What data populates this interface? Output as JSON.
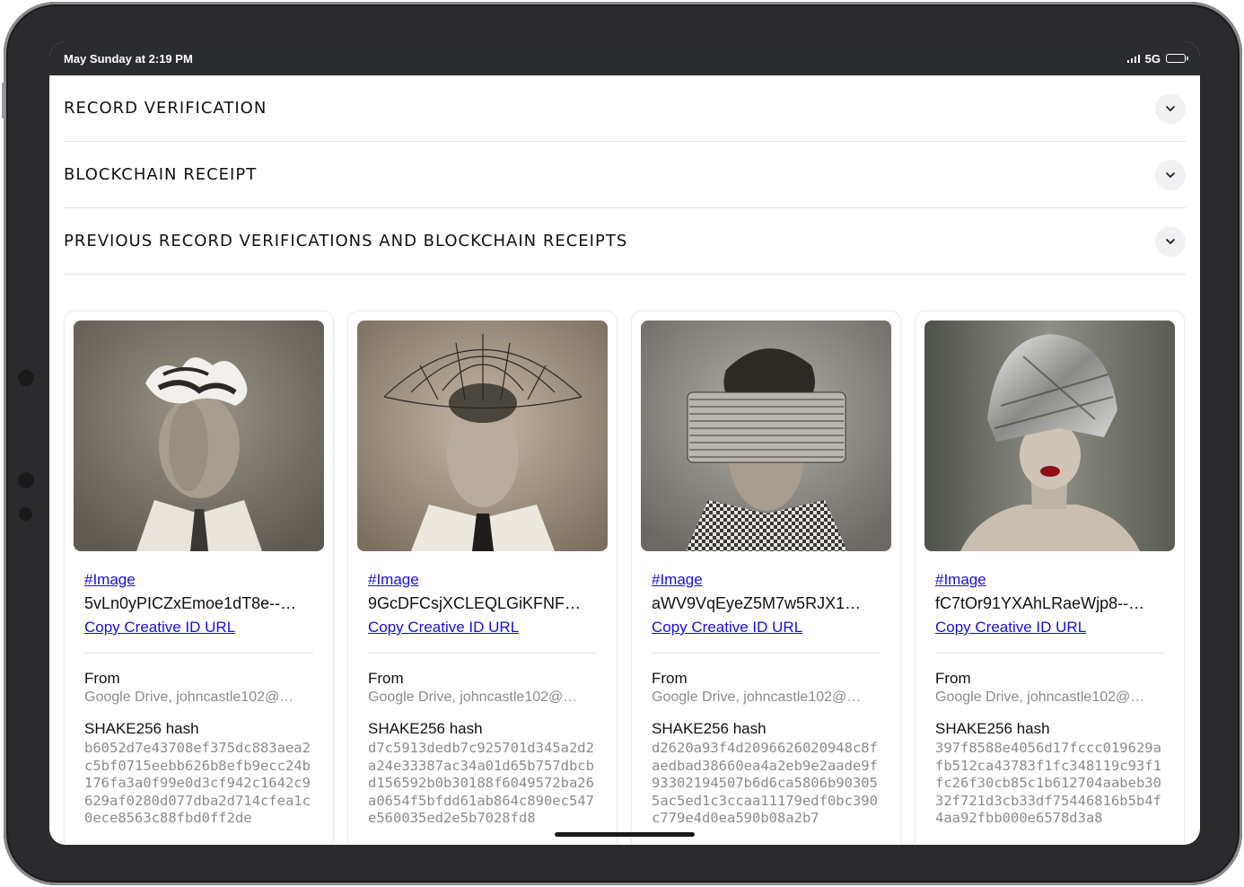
{
  "status": {
    "time": "May Sunday at 2:19 PM",
    "network": "5G"
  },
  "accordion": [
    {
      "title": "RECORD VERIFICATION"
    },
    {
      "title": "BLOCKCHAIN RECEIPT"
    },
    {
      "title": "PREVIOUS RECORD VERIFICATIONS AND BLOCKCHAIN RECEIPTS"
    }
  ],
  "cards": [
    {
      "tag": "#Image",
      "creative_id": "5vLn0yPICZxEmoe1dT8e--…",
      "copy_label": "Copy Creative ID URL",
      "from_label": "From",
      "from_value": "Google Drive, johncastle102@…",
      "hash_label": "SHAKE256 hash",
      "hash_value": "b6052d7e43708ef375dc883aea2c5bf0715eebb626b8efb9ecc24b176fa3a0f99e0d3cf942c1642c9629af0280d077dba2d714cfea1c0ece8563c88fbd0ff2de"
    },
    {
      "tag": "#Image",
      "creative_id": "9GcDFCsjXCLEQLGiKFNF…",
      "copy_label": "Copy Creative ID URL",
      "from_label": "From",
      "from_value": "Google Drive, johncastle102@…",
      "hash_label": "SHAKE256 hash",
      "hash_value": "d7c5913dedb7c925701d345a2d2a24e33387ac34a01d65b757dbcbd156592b0b30188f6049572ba26a0654f5bfdd61ab864c890ec547e560035ed2e5b7028fd8"
    },
    {
      "tag": "#Image",
      "creative_id": "aWV9VqEyeZ5M7w5RJX1…",
      "copy_label": "Copy Creative ID URL",
      "from_label": "From",
      "from_value": "Google Drive, johncastle102@…",
      "hash_label": "SHAKE256 hash",
      "hash_value": "d2620a93f4d2096626020948c8faedbad38660ea4a2eb9e2aade9f93302194507b6d6ca5806b903055ac5ed1c3ccaa11179edf0bc390c779e4d0ea590b08a2b7"
    },
    {
      "tag": "#Image",
      "creative_id": "fC7tOr91YXAhLRaeWjp8--…",
      "copy_label": "Copy Creative ID URL",
      "from_label": "From",
      "from_value": "Google Drive, johncastle102@…",
      "hash_label": "SHAKE256 hash",
      "hash_value": "397f8588e4056d17fccc019629afb512ca43783f1fc348119c93f1fc26f30cb85c1b612704aabeb3032f721d3cb33df75446816b5b4f4aa92fbb000e6578d3a8"
    }
  ],
  "icons": {
    "chevron": "chevron-down-icon",
    "signal": "signal-icon",
    "battery": "battery-icon"
  }
}
